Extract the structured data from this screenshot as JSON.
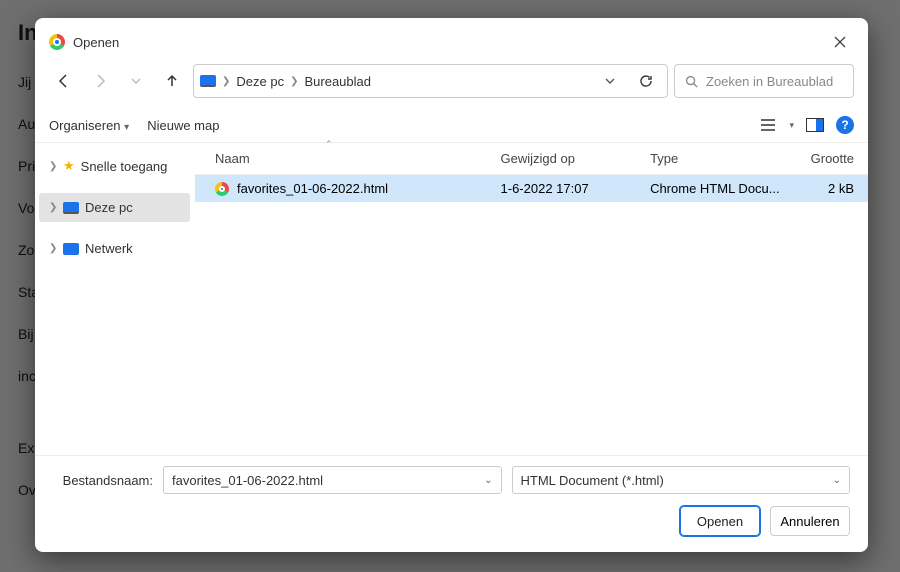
{
  "bg": {
    "title": "Install",
    "link": "Jij en",
    "rows": [
      "Auto",
      "Priv",
      "Vorm",
      "Zoek",
      "Stan",
      "Bij op",
      "incee",
      "Exte",
      "Over"
    ]
  },
  "dialog_title": "Openen",
  "breadcrumb": {
    "pc": "Deze pc",
    "loc": "Bureaublad"
  },
  "search_placeholder": "Zoeken in Bureaublad",
  "toolbar": {
    "organize": "Organiseren",
    "newfolder": "Nieuwe map"
  },
  "tree": {
    "quick": "Snelle toegang",
    "pc": "Deze pc",
    "net": "Netwerk"
  },
  "columns": {
    "name": "Naam",
    "modified": "Gewijzigd op",
    "type": "Type",
    "size": "Grootte"
  },
  "file": {
    "name": "favorites_01-06-2022.html",
    "modified": "1-6-2022 17:07",
    "type": "Chrome HTML Docu...",
    "size": "2 kB"
  },
  "filename_label": "Bestandsnaam:",
  "filename_value": "favorites_01-06-2022.html",
  "filter": "HTML Document (*.html)",
  "open": "Openen",
  "cancel": "Annuleren"
}
